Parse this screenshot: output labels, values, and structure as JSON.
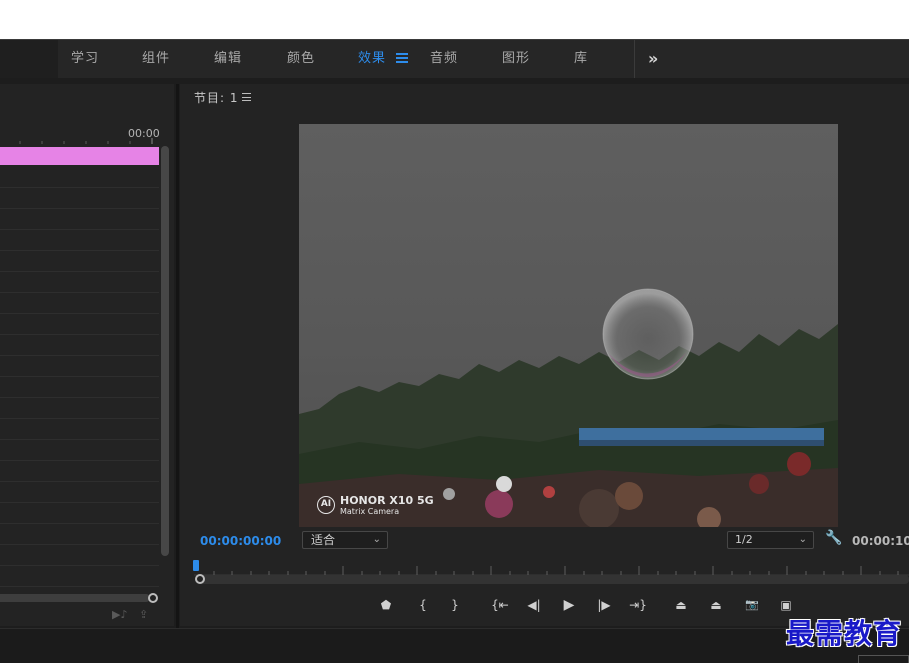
{
  "workspace_tabs": [
    {
      "label": "学习"
    },
    {
      "label": "组件"
    },
    {
      "label": "编辑"
    },
    {
      "label": "颜色"
    },
    {
      "label": "效果",
      "active": true
    },
    {
      "label": "音频"
    },
    {
      "label": "图形"
    },
    {
      "label": "库"
    }
  ],
  "workspace_more": "»",
  "timeline": {
    "timecode": "00:00",
    "clip_color": "#e683e6"
  },
  "monitor": {
    "title": "节目: 1",
    "current_timecode": "00:00:00:00",
    "fit_option": "适合",
    "quality_option": "1/2",
    "duration_timecode": "00:00:10",
    "watermark_brand": "HONOR X10 5G",
    "watermark_sub": "Matrix Camera",
    "watermark_logo": "AI"
  },
  "controls": [
    {
      "name": "add-marker-button",
      "glyph": "⬟",
      "icon": "marker-icon"
    },
    {
      "name": "mark-in-button",
      "glyph": "{",
      "icon": "mark-in-icon"
    },
    {
      "name": "mark-out-button",
      "glyph": "}",
      "icon": "mark-out-icon"
    },
    {
      "name": "go-to-in-button",
      "glyph": "{⇤",
      "icon": "go-to-in-icon"
    },
    {
      "name": "step-back-button",
      "glyph": "◀|",
      "icon": "step-back-icon"
    },
    {
      "name": "play-button",
      "glyph": "▶",
      "icon": "play-icon"
    },
    {
      "name": "step-forward-button",
      "glyph": "|▶",
      "icon": "step-forward-icon"
    },
    {
      "name": "go-to-out-button",
      "glyph": "⇥}",
      "icon": "go-to-out-icon"
    },
    {
      "name": "lift-button",
      "glyph": "⏏",
      "icon": "lift-icon"
    },
    {
      "name": "extract-button",
      "glyph": "⏏",
      "icon": "extract-icon"
    },
    {
      "name": "export-frame-button",
      "glyph": "📷",
      "icon": "camera-icon"
    },
    {
      "name": "comparison-view-button",
      "glyph": "▣",
      "icon": "comparison-icon"
    }
  ],
  "overlay_watermark": "最需教育",
  "colors": {
    "accent": "#2d8ceb",
    "panel_bg": "#232323",
    "clip": "#e683e6"
  }
}
